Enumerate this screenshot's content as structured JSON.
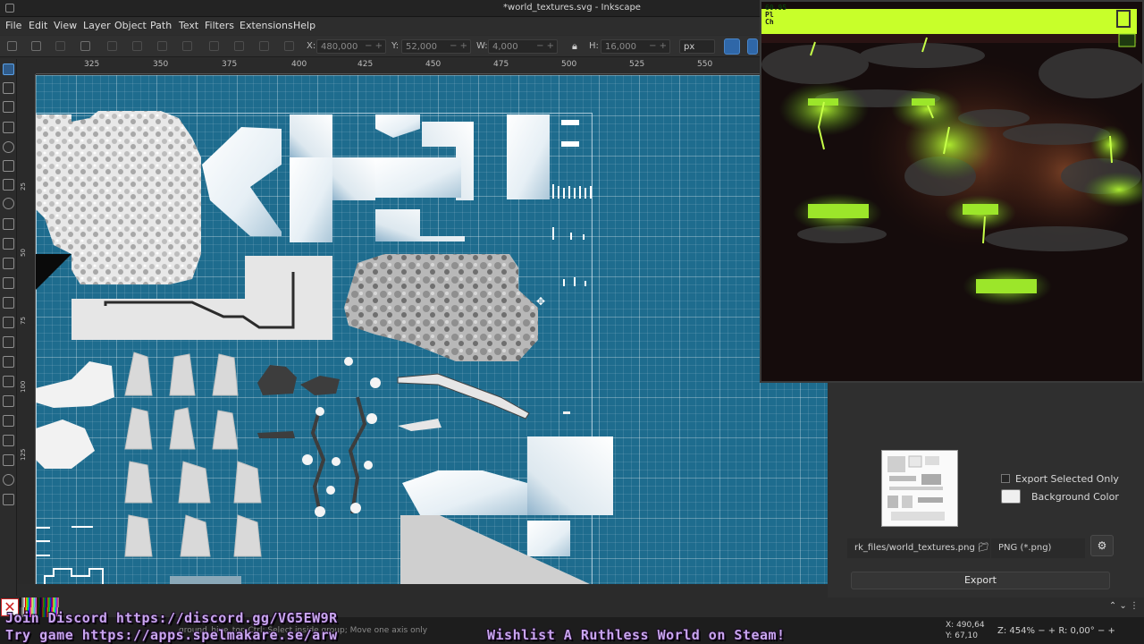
{
  "window": {
    "title": "*world_textures.svg - Inkscape"
  },
  "menu": [
    "File",
    "Edit",
    "View",
    "Layer",
    "Object",
    "Path",
    "Text",
    "Filters",
    "Extensions",
    "Help"
  ],
  "controls": {
    "x_label": "X:",
    "x_value": "480,000",
    "y_label": "Y:",
    "y_value": "52,000",
    "w_label": "W:",
    "w_value": "4,000",
    "h_label": "H:",
    "h_value": "16,000",
    "unit": "px",
    "pm": "− +"
  },
  "ruler": {
    "h_ticks": [
      "325",
      "350",
      "375",
      "400",
      "425",
      "450",
      "475",
      "500",
      "525",
      "550"
    ],
    "v_ticks": [
      "25",
      "50",
      "75",
      "100",
      "125"
    ]
  },
  "game": {
    "hud_line1": "60.95",
    "hud_line2": "Pl",
    "hud_line3": "Ch"
  },
  "export": {
    "export_selected_only": "Export Selected Only",
    "background_color": "Background Color",
    "filename": "rk_files/world_textures.png",
    "filetype": "PNG (*.png)",
    "export_button": "Export",
    "gear": "⚙"
  },
  "status": {
    "hint": "ground_hive_top      Ctrl: Select inside group; Move one axis only",
    "x_label": "X:",
    "x_value": "490,64",
    "y_label": "Y:",
    "y_value": "67,10",
    "zoom_label": "Z:",
    "zoom_value": "454%",
    "rotation_label": "R:",
    "rotation_value": "0,00°",
    "zoom_pm": "− +"
  },
  "overlay": {
    "discord": "Join Discord https://discord.gg/VG5EW9R",
    "try_game": "Try game https://apps.spelmakare.se/arw",
    "wishlist": "Wishlist A Ruthless World on Steam!"
  },
  "palette_colors": [
    "#000000",
    "#1a1a1a",
    "#333333",
    "#4d4d4d",
    "#666666",
    "#808080",
    "#999999",
    "#b3b3b3",
    "#cccccc",
    "#e6e6e6",
    "#ffffff",
    "#800000",
    "#ff0000",
    "#ff6600",
    "#ffcc00",
    "#ffff00",
    "#80ff00",
    "#00ff00",
    "#00ff80",
    "#00ffff",
    "#0080ff",
    "#0000ff",
    "#8000ff",
    "#ff00ff",
    "#ff0080",
    "#ff8080",
    "#ffb380",
    "#ffe680",
    "#ffff80",
    "#ccff80",
    "#80ff80",
    "#80ffcc",
    "#80ffff",
    "#80ccff",
    "#8080ff",
    "#cc80ff",
    "#ff80ff",
    "#ff80cc",
    "#400000",
    "#402000",
    "#404000",
    "#204000",
    "#004000",
    "#004020",
    "#004040",
    "#002040",
    "#000040",
    "#200040",
    "#400040",
    "#400020",
    "#800040",
    "#804000",
    "#808000",
    "#408000",
    "#008000",
    "#008040",
    "#008080",
    "#004080",
    "#000080",
    "#400080",
    "#800080",
    "#c00000",
    "#c06000",
    "#c0c000",
    "#60c000",
    "#00c000",
    "#00c060",
    "#00c0c0",
    "#0060c0",
    "#0000c0",
    "#6000c0",
    "#c000c0",
    "#c00060",
    "#ff4040",
    "#ffa040",
    "#ffff40",
    "#a0ff40",
    "#40ff40",
    "#40ffa0",
    "#40ffff",
    "#40a0ff",
    "#4040ff",
    "#a040ff",
    "#ff40ff",
    "#ff40a0",
    "#e0c0a0",
    "#c0a080"
  ]
}
